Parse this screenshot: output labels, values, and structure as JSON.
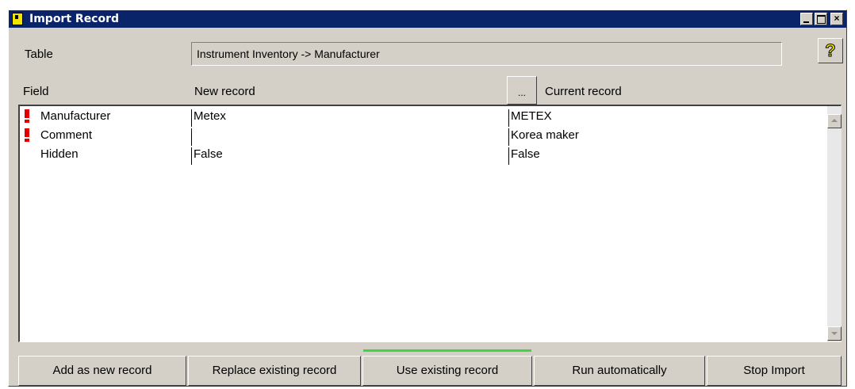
{
  "window": {
    "title": "Import Record"
  },
  "table": {
    "label": "Table",
    "value": "Instrument Inventory -> Manufacturer"
  },
  "columns": {
    "field": "Field",
    "new_record": "New record",
    "dots": "...",
    "current_record": "Current record"
  },
  "rows": [
    {
      "warning": true,
      "field": "Manufacturer",
      "new": "Metex",
      "current": "METEX"
    },
    {
      "warning": true,
      "field": "Comment",
      "new": "",
      "current": "Korea maker"
    },
    {
      "warning": false,
      "field": "Hidden",
      "new": "False",
      "current": "False"
    }
  ],
  "buttons": {
    "add_new": "Add as new record",
    "replace": "Replace existing record",
    "use_existing": "Use existing record",
    "run_auto": "Run automatically",
    "stop": "Stop Import"
  },
  "icons": {
    "help": "?",
    "warning_color": "#e00000",
    "progress_color": "#3cd640",
    "titlebar_color": "#0a246a"
  }
}
